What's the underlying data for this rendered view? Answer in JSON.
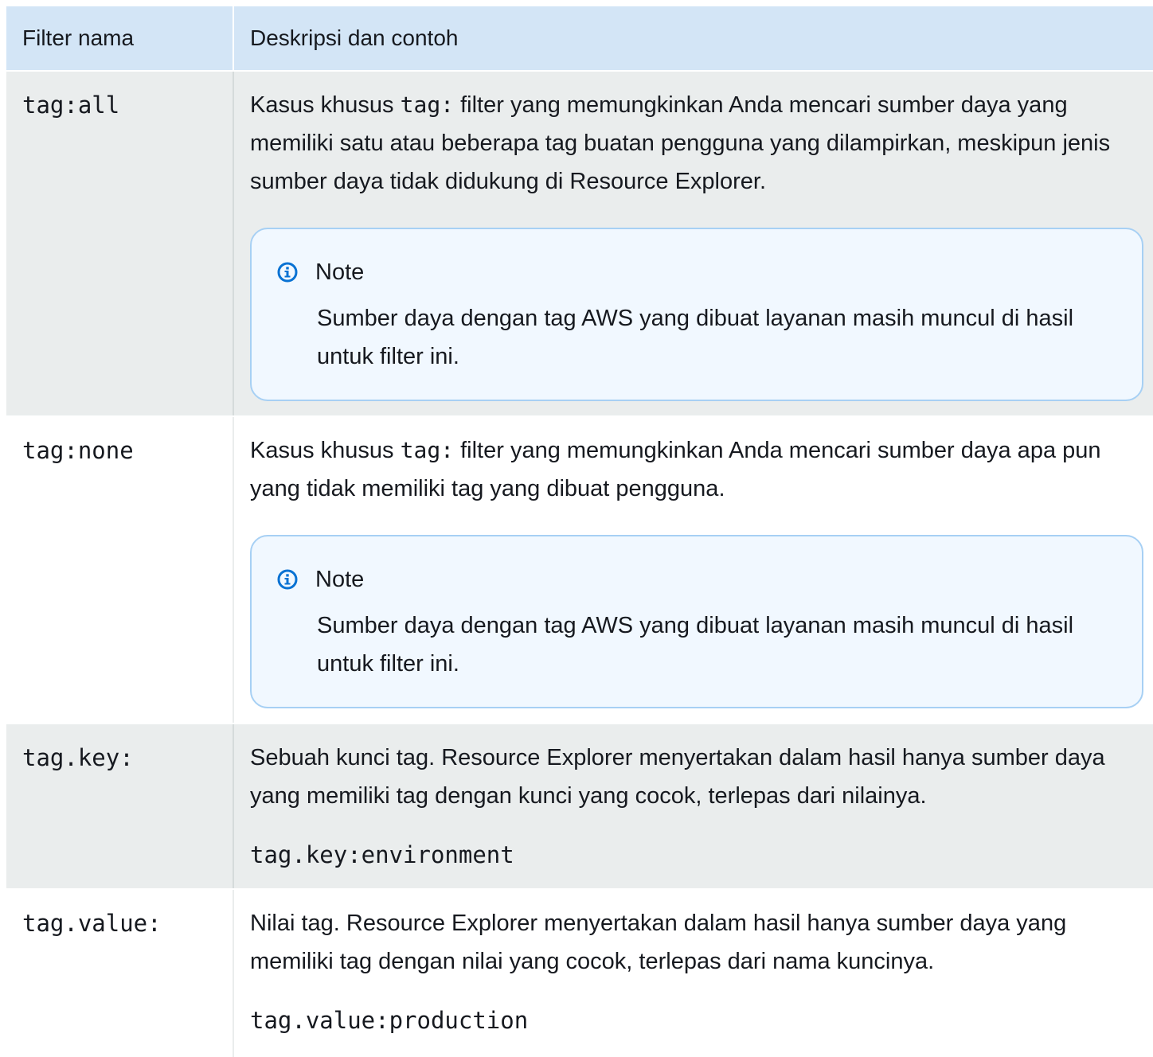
{
  "table": {
    "headers": {
      "name": "Filter nama",
      "description": "Deskripsi dan contoh"
    },
    "rows": [
      {
        "name": "tag:all",
        "desc_before": "Kasus khusus ",
        "desc_code": "tag:",
        "desc_after": " filter yang memungkinkan Anda mencari sumber daya yang memiliki satu atau beberapa tag buatan pengguna yang dilampirkan, meskipun jenis sumber daya tidak didukung di Resource Explorer.",
        "note_title": "Note",
        "note_text": "Sumber daya dengan tag AWS yang dibuat layanan masih muncul di hasil untuk filter ini."
      },
      {
        "name": "tag:none",
        "desc_before": "Kasus khusus ",
        "desc_code": "tag:",
        "desc_after": " filter yang memungkinkan Anda mencari sumber daya apa pun yang tidak memiliki tag yang dibuat pengguna.",
        "note_title": "Note",
        "note_text": "Sumber daya dengan tag AWS yang dibuat layanan masih muncul di hasil untuk filter ini."
      },
      {
        "name": "tag.key:",
        "desc": "Sebuah kunci tag. Resource Explorer menyertakan dalam hasil hanya sumber daya yang memiliki tag dengan kunci yang cocok, terlepas dari nilainya.",
        "example": "tag.key:environment"
      },
      {
        "name": "tag.value:",
        "desc": "Nilai tag. Resource Explorer menyertakan dalam hasil hanya sumber daya yang memiliki tag dengan nilai yang cocok, terlepas dari nama kuncinya.",
        "example": "tag.value:production"
      }
    ]
  },
  "colors": {
    "header_bg": "#d3e5f6",
    "stripe_bg": "#eaeded",
    "note_bg": "#f1f8ff",
    "note_border": "#a7d0f4",
    "info_icon": "#0972d3"
  },
  "icons": {
    "note": "info-icon"
  }
}
